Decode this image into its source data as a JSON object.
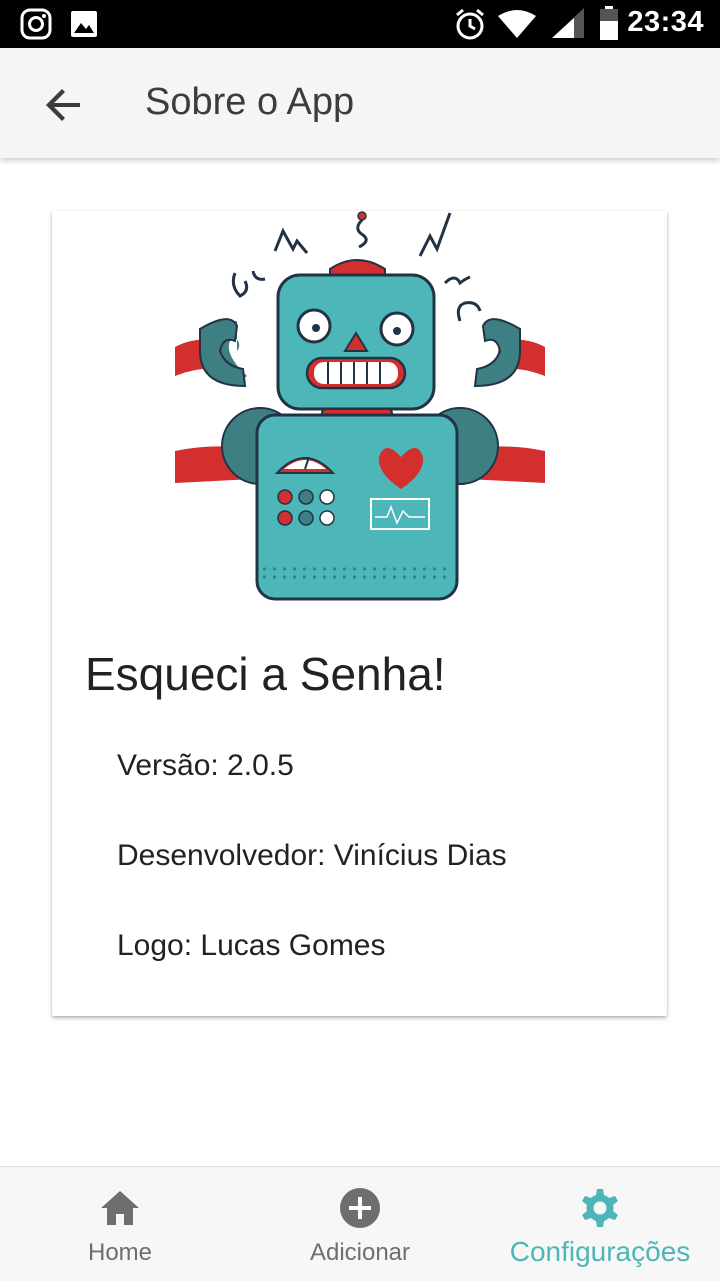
{
  "status_bar": {
    "time": "23:34",
    "icons": [
      "instagram-icon",
      "image-icon",
      "alarm-icon",
      "wifi-icon",
      "signal-icon",
      "battery-icon"
    ]
  },
  "app_bar": {
    "title": "Sobre o App",
    "back_icon": "arrow-back-icon"
  },
  "about": {
    "app_name": "Esqueci a Senha!",
    "version": "Versão: 2.0.5",
    "developer": "Desenvolvedor: Vinícius Dias",
    "logo_credit": "Logo: Lucas Gomes",
    "logo_icon": "robot-logo"
  },
  "bottom_nav": {
    "items": [
      {
        "label": "Home",
        "icon": "home-icon",
        "active": false
      },
      {
        "label": "Adicionar",
        "icon": "add-circle-icon",
        "active": false
      },
      {
        "label": "Configurações",
        "icon": "gear-icon",
        "active": true
      }
    ]
  },
  "colors": {
    "accent": "#4db6b8",
    "robot_teal": "#4db6b8",
    "robot_red": "#d32f2f",
    "nav_inactive": "#6e6e6e"
  }
}
